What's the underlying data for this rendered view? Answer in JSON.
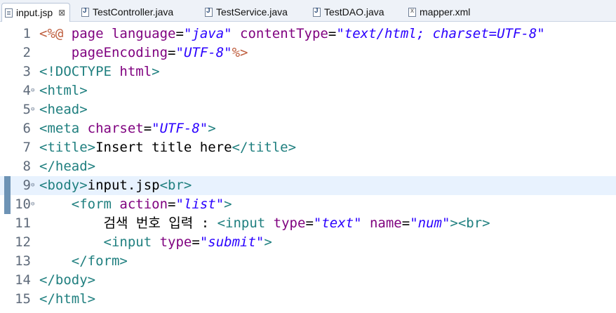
{
  "tabs": [
    {
      "label": "input.jsp",
      "icon": "jsp-file-icon",
      "active": true,
      "close": "⊠"
    },
    {
      "label": "TestController.java",
      "icon": "java-file-icon",
      "active": false
    },
    {
      "label": "TestService.java",
      "icon": "java-file-icon",
      "active": false
    },
    {
      "label": "TestDAO.java",
      "icon": "java-file-icon",
      "active": false
    },
    {
      "label": "mapper.xml",
      "icon": "xml-file-icon",
      "active": false
    }
  ],
  "lines": [
    {
      "n": "1",
      "tokens": [
        [
          "j",
          "<%@ "
        ],
        [
          "a",
          "page "
        ],
        [
          "a",
          "language"
        ],
        [
          "tx",
          "="
        ],
        [
          "v",
          "\"java\""
        ],
        [
          "tx",
          " "
        ],
        [
          "a",
          "contentType"
        ],
        [
          "tx",
          "="
        ],
        [
          "v",
          "\"text/html; charset=UTF-8\""
        ]
      ]
    },
    {
      "n": "2",
      "tokens": [
        [
          "tx",
          "    "
        ],
        [
          "a",
          "pageEncoding"
        ],
        [
          "tx",
          "="
        ],
        [
          "v",
          "\"UTF-8\""
        ],
        [
          "j",
          "%>"
        ]
      ]
    },
    {
      "n": "3",
      "tokens": [
        [
          "t",
          "<!DOCTYPE "
        ],
        [
          "a",
          "html"
        ],
        [
          "t",
          ">"
        ]
      ]
    },
    {
      "n": "4",
      "fold": "⊖",
      "tokens": [
        [
          "t",
          "<html>"
        ]
      ]
    },
    {
      "n": "5",
      "fold": "⊖",
      "tokens": [
        [
          "t",
          "<head>"
        ]
      ]
    },
    {
      "n": "6",
      "tokens": [
        [
          "t",
          "<meta "
        ],
        [
          "a",
          "charset"
        ],
        [
          "tx",
          "="
        ],
        [
          "v",
          "\"UTF-8\""
        ],
        [
          "t",
          ">"
        ]
      ]
    },
    {
      "n": "7",
      "tokens": [
        [
          "t",
          "<title>"
        ],
        [
          "tx",
          "Insert title here"
        ],
        [
          "t",
          "</title>"
        ]
      ]
    },
    {
      "n": "8",
      "tokens": [
        [
          "t",
          "</head>"
        ]
      ]
    },
    {
      "n": "9",
      "fold": "⊖",
      "highlight": true,
      "tokens": [
        [
          "t",
          "<body>"
        ],
        [
          "tx",
          "input.jsp"
        ],
        [
          "t",
          "<br>"
        ]
      ]
    },
    {
      "n": "10",
      "fold": "⊖",
      "tokens": [
        [
          "tx",
          "    "
        ],
        [
          "t",
          "<form "
        ],
        [
          "a",
          "action"
        ],
        [
          "tx",
          "="
        ],
        [
          "v",
          "\"list\""
        ],
        [
          "t",
          ">"
        ]
      ]
    },
    {
      "n": "11",
      "tokens": [
        [
          "tx",
          "        검색 번호 입력 : "
        ],
        [
          "t",
          "<input "
        ],
        [
          "a",
          "type"
        ],
        [
          "tx",
          "="
        ],
        [
          "v",
          "\"text\""
        ],
        [
          "tx",
          " "
        ],
        [
          "a",
          "name"
        ],
        [
          "tx",
          "="
        ],
        [
          "v",
          "\"num\""
        ],
        [
          "t",
          "><br>"
        ]
      ]
    },
    {
      "n": "12",
      "tokens": [
        [
          "tx",
          "        "
        ],
        [
          "t",
          "<input "
        ],
        [
          "a",
          "type"
        ],
        [
          "tx",
          "="
        ],
        [
          "v",
          "\"submit\""
        ],
        [
          "t",
          ">"
        ]
      ]
    },
    {
      "n": "13",
      "tokens": [
        [
          "tx",
          "    "
        ],
        [
          "t",
          "</form>"
        ]
      ]
    },
    {
      "n": "14",
      "tokens": [
        [
          "t",
          "</body>"
        ]
      ]
    },
    {
      "n": "15",
      "tokens": [
        [
          "t",
          "</html>"
        ]
      ]
    }
  ]
}
